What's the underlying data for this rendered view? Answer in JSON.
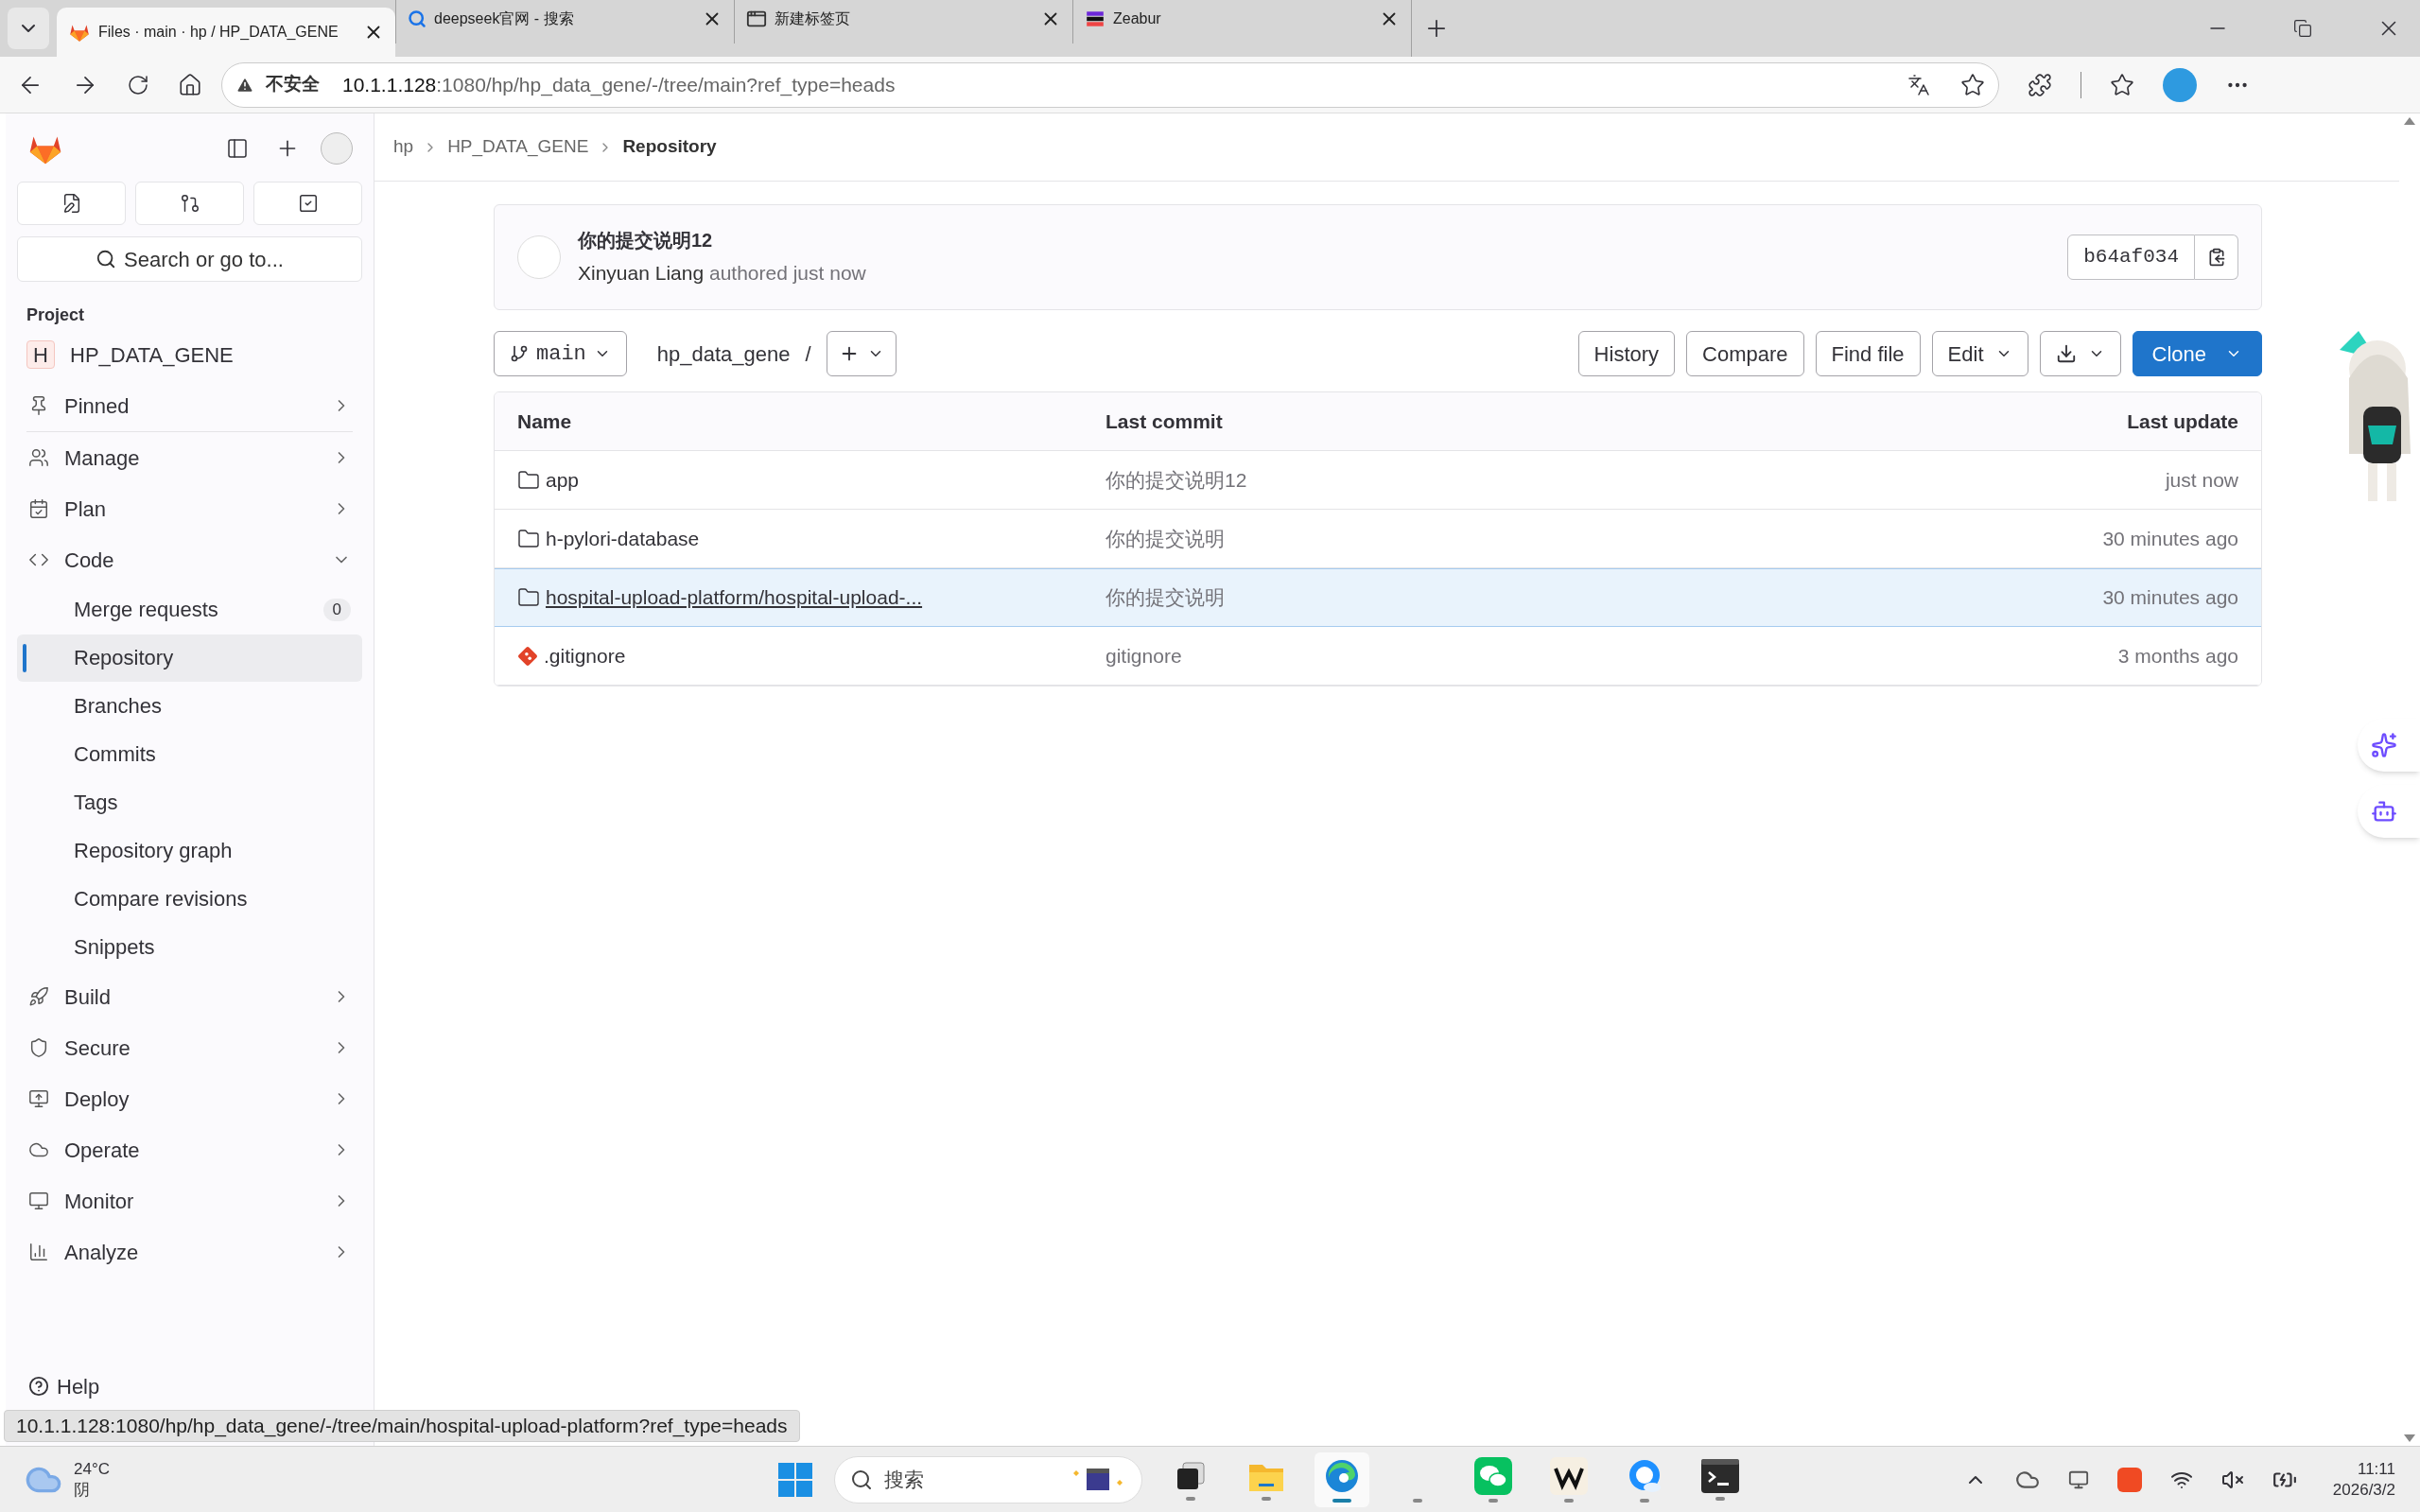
{
  "browser": {
    "tabs": [
      {
        "title": "Files · main · hp / HP_DATA_GENE",
        "kind": "gitlab",
        "selected": true
      },
      {
        "title": "deepseek官网 - 搜索",
        "kind": "search",
        "selected": false
      },
      {
        "title": "新建标签页",
        "kind": "newtab",
        "selected": false
      },
      {
        "title": "Zeabur",
        "kind": "zeabur",
        "selected": false
      }
    ],
    "security": "不安全",
    "host": "10.1.1.128",
    "path": ":1080/hp/hp_data_gene/-/tree/main?ref_type=heads"
  },
  "sidebar": {
    "search_placeholder": "Search or go to...",
    "section_label": "Project",
    "project": {
      "initial": "H",
      "name": "HP_DATA_GENE"
    },
    "items": [
      {
        "label": "Pinned",
        "kind": "section",
        "expanded": false
      },
      {
        "label": "Manage",
        "kind": "section",
        "expanded": false
      },
      {
        "label": "Plan",
        "kind": "section",
        "expanded": false
      },
      {
        "label": "Code",
        "kind": "section",
        "expanded": true
      },
      {
        "label": "Merge requests",
        "kind": "sub",
        "selected": false,
        "count": "0"
      },
      {
        "label": "Repository",
        "kind": "sub",
        "selected": true
      },
      {
        "label": "Branches",
        "kind": "sub",
        "selected": false
      },
      {
        "label": "Commits",
        "kind": "sub",
        "selected": false
      },
      {
        "label": "Tags",
        "kind": "sub",
        "selected": false
      },
      {
        "label": "Repository graph",
        "kind": "sub",
        "selected": false
      },
      {
        "label": "Compare revisions",
        "kind": "sub",
        "selected": false
      },
      {
        "label": "Snippets",
        "kind": "sub",
        "selected": false
      },
      {
        "label": "Build",
        "kind": "section",
        "expanded": false
      },
      {
        "label": "Secure",
        "kind": "section",
        "expanded": false
      },
      {
        "label": "Deploy",
        "kind": "section",
        "expanded": false
      },
      {
        "label": "Operate",
        "kind": "section",
        "expanded": false
      },
      {
        "label": "Monitor",
        "kind": "section",
        "expanded": false
      },
      {
        "label": "Analyze",
        "kind": "section",
        "expanded": false
      }
    ],
    "help": "Help"
  },
  "breadcrumb": [
    "hp",
    "HP_DATA_GENE",
    "Repository"
  ],
  "commit": {
    "title": "你的提交说明12",
    "author": "Xinyuan Liang",
    "action": "authored just now",
    "sha": "b64af034"
  },
  "toolbar": {
    "branch": "main",
    "path": "hp_data_gene",
    "separator": "/",
    "buttons": [
      {
        "label": "History",
        "kind": "plain"
      },
      {
        "label": "Compare",
        "kind": "plain"
      },
      {
        "label": "Find file",
        "kind": "plain"
      },
      {
        "label": "Edit",
        "kind": "dropdown"
      },
      {
        "kind": "download"
      },
      {
        "label": "Clone",
        "kind": "primary"
      }
    ]
  },
  "table": {
    "columns": [
      "Name",
      "Last commit",
      "Last update"
    ],
    "rows": [
      {
        "name": "app",
        "kind": "folder",
        "commit": "你的提交说明12",
        "updated": "just now",
        "selected": false
      },
      {
        "name": "h-pylori-database",
        "kind": "folder",
        "commit": "你的提交说明",
        "updated": "30 minutes ago",
        "selected": false
      },
      {
        "name": "hospital-upload-platform/hospital-upload-...",
        "kind": "folder",
        "commit": "你的提交说明",
        "updated": "30 minutes ago",
        "selected": true
      },
      {
        "name": ".gitignore",
        "kind": "git",
        "commit": "gitignore",
        "updated": "3 months ago",
        "selected": false
      }
    ]
  },
  "status_url": "10.1.1.128:1080/hp/hp_data_gene/-/tree/main/hospital-upload-platform?ref_type=heads",
  "taskbar": {
    "temperature": "24°C",
    "condition": "阴",
    "search_placeholder": "搜索",
    "time": "11:11",
    "date": "2026/3/2",
    "apps": [
      {
        "kind": "blocks",
        "active": false
      },
      {
        "kind": "folder",
        "active": false
      },
      {
        "kind": "edge",
        "active": true
      },
      {
        "kind": "blank",
        "active": false
      },
      {
        "kind": "wechat",
        "active": false
      },
      {
        "kind": "w",
        "active": false
      },
      {
        "kind": "qq",
        "active": false
      },
      {
        "kind": "terminal",
        "active": false
      }
    ]
  }
}
